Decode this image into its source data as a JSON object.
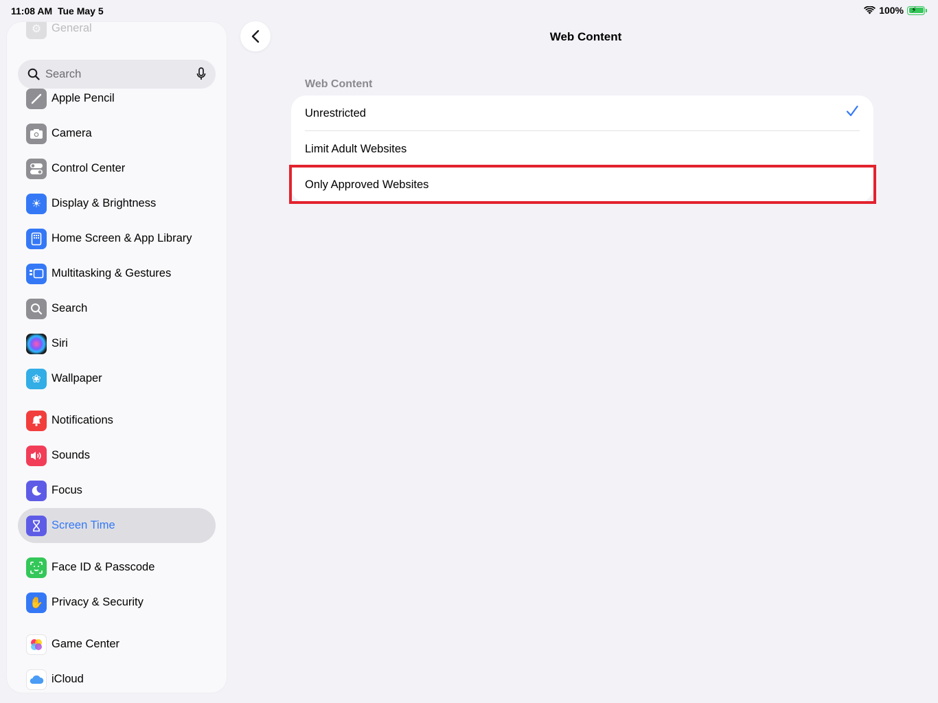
{
  "status_bar": {
    "time": "11:08 AM",
    "date": "Tue May 5",
    "battery": "100%"
  },
  "sidebar": {
    "search_placeholder": "Search",
    "partial_top_label": "General",
    "items": [
      {
        "label": "Apple Pencil",
        "icon": "pencil-icon",
        "color": "#8e8e93"
      },
      {
        "label": "Camera",
        "icon": "camera-icon",
        "color": "#8e8e93"
      },
      {
        "label": "Control Center",
        "icon": "toggles-icon",
        "color": "#8e8e93"
      },
      {
        "label": "Display & Brightness",
        "icon": "sun-icon",
        "color": "#3478f6"
      },
      {
        "label": "Home Screen & App Library",
        "icon": "home-screen-icon",
        "color": "#3478f6"
      },
      {
        "label": "Multitasking & Gestures",
        "icon": "multitasking-icon",
        "color": "#3478f6"
      },
      {
        "label": "Search",
        "icon": "magnifier-icon",
        "color": "#8e8e93"
      },
      {
        "label": "Siri",
        "icon": "siri-icon",
        "color": "#1c1c1e"
      },
      {
        "label": "Wallpaper",
        "icon": "flower-icon",
        "color": "#32ade6"
      },
      {
        "label": "Notifications",
        "icon": "bell-icon",
        "color": "#f23d3d"
      },
      {
        "label": "Sounds",
        "icon": "speaker-icon",
        "color": "#f23d58"
      },
      {
        "label": "Focus",
        "icon": "moon-icon",
        "color": "#5e5ce6"
      },
      {
        "label": "Screen Time",
        "icon": "hourglass-icon",
        "color": "#5e5ce6",
        "selected": true
      },
      {
        "label": "Face ID & Passcode",
        "icon": "face-id-icon",
        "color": "#34c759"
      },
      {
        "label": "Privacy & Security",
        "icon": "hand-icon",
        "color": "#3478f6"
      },
      {
        "label": "Game Center",
        "icon": "game-center-icon",
        "color": "#ffffff"
      },
      {
        "label": "iCloud",
        "icon": "cloud-icon",
        "color": "#ffffff"
      }
    ]
  },
  "main": {
    "title": "Web Content",
    "section_header": "Web Content",
    "options": [
      {
        "label": "Unrestricted",
        "checked": true
      },
      {
        "label": "Limit Adult Websites",
        "checked": false
      },
      {
        "label": "Only Approved Websites",
        "checked": false,
        "highlighted": true
      }
    ],
    "accent_color": "#3478f6",
    "highlight_color": "#e2232e"
  }
}
